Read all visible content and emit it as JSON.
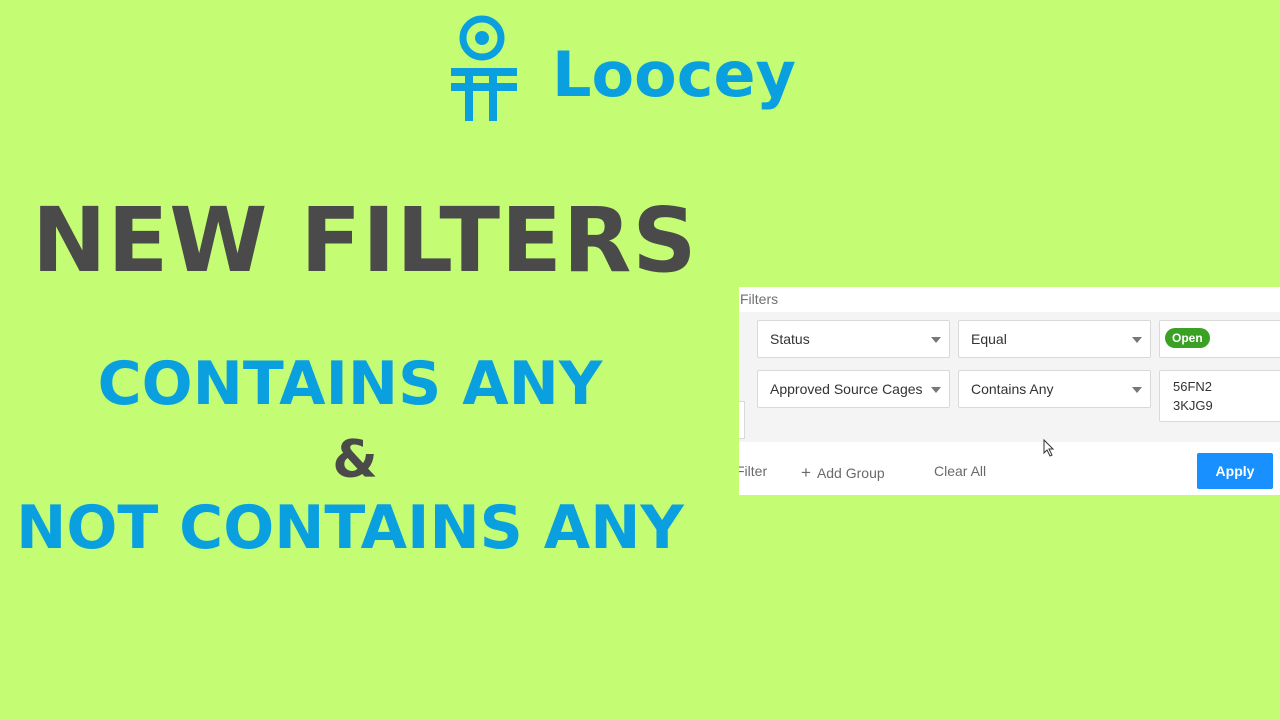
{
  "brand": {
    "name": "Loocey",
    "color": "#0aa0e0"
  },
  "headline": "NEW FILTERS",
  "subheadings": {
    "line1": "CONTAINS ANY",
    "line2": "&",
    "line3": "NOT CONTAINS ANY"
  },
  "filters_panel": {
    "title": "Filters",
    "rows": [
      {
        "field": "Status",
        "operator": "Equal",
        "value_badge": "Open"
      },
      {
        "field": "Approved Source Cages",
        "operator": "Contains Any",
        "values": [
          "56FN2",
          "3KJG9"
        ]
      }
    ],
    "footer": {
      "add_filter_label": "Filter",
      "add_group_icon": "plus-icon",
      "add_group_label": "Add Group",
      "clear_all_label": "Clear All",
      "apply_label": "Apply"
    }
  },
  "colors": {
    "background": "#c4fd74",
    "accent": "#0aa0e0",
    "dark_text": "#4a4a4a",
    "apply_button": "#1890ff",
    "open_badge": "#3aa124"
  }
}
